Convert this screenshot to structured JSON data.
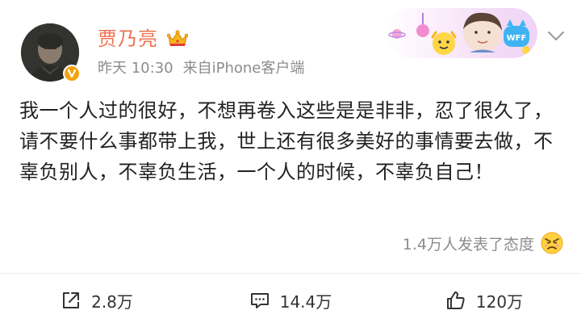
{
  "post": {
    "username": "贾乃亮",
    "time": "昨天 10:30",
    "source": "来自iPhone客户端",
    "text": "我一个人过的很好，不想再卷入这些是是非非，忍了很久了，请不要什么事都带上我，世上还有很多美好的事情要去做，不辜负别人，不辜负生活，一个人的时候，不辜负自己！",
    "reactions_summary": "1.4万人发表了态度",
    "reaction_emoji": "angry-face-icon"
  },
  "decor_banner": {
    "badge_text": "WFF"
  },
  "actions": {
    "repost_count": "2.8万",
    "comment_count": "14.4万",
    "like_count": "120万"
  },
  "colors": {
    "username": "#eb7350",
    "meta": "#8c8c8c",
    "body_text": "#222222",
    "verified_badge": "#f3a310"
  },
  "icons": {
    "more": "chevron-down-icon",
    "repost": "share-icon",
    "comment": "comment-icon",
    "like": "thumbs-up-icon",
    "vip": "crown-icon",
    "verified": "verified-v-icon"
  }
}
